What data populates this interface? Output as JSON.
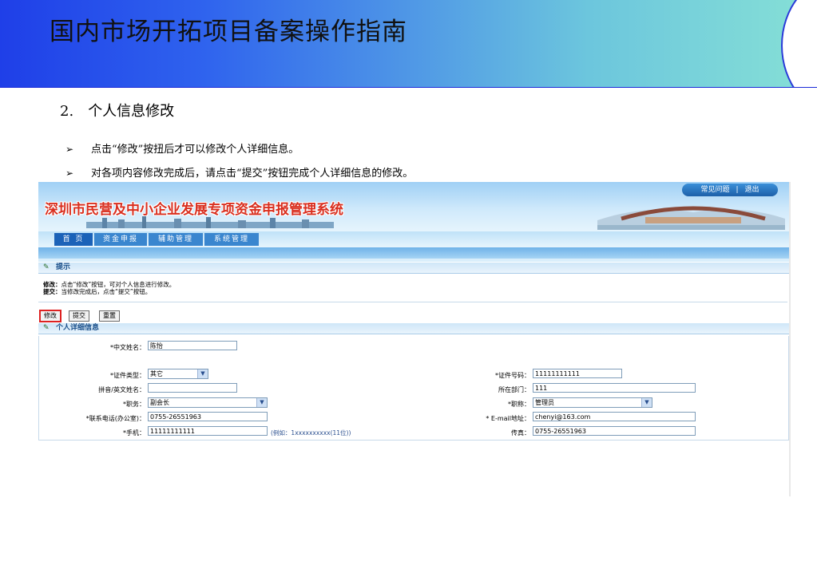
{
  "slide": {
    "title": "国内市场开拓项目备案操作指南",
    "section_number": "2.",
    "section_title": "个人信息修改",
    "bullets": [
      "点击“修改”按扭后才可以修改个人详细信息。",
      "对各项内容修改完成后，请点击“提交”按钮完成个人详细信息的修改。"
    ],
    "bullet_glyph": "➢"
  },
  "web": {
    "system_title": "深圳市民营及中小企业发展专项资金申报管理系统",
    "top_links": [
      "常见问题",
      "|",
      "退出"
    ],
    "nav": [
      "首 页",
      "资金申报",
      "辅助管理",
      "系统管理"
    ],
    "tips_header": "提示",
    "tips": [
      {
        "label": "修改：",
        "text": "点击“修改”按钮，可对个人信息进行修改。"
      },
      {
        "label": "提交：",
        "text": "当修改完成后，点击“提交”按钮。"
      }
    ],
    "buttons": {
      "edit": "修改",
      "submit": "提交",
      "reset": "重置"
    },
    "detail_header": "个人详细信息",
    "form": {
      "chinese_name": {
        "label": "*中文姓名：",
        "value": "陈怡"
      },
      "id_type": {
        "label": "*证件类型：",
        "value": "其它"
      },
      "id_number": {
        "label": "*证件号码：",
        "value": "11111111111"
      },
      "pinyin_name": {
        "label": "拼音/英文姓名：",
        "value": ""
      },
      "department": {
        "label": "所在部门：",
        "value": "111"
      },
      "position": {
        "label": "*职务：",
        "value": "副会长"
      },
      "job_title": {
        "label": "*职称：",
        "value": "管理员"
      },
      "office_phone": {
        "label": "*联系电话(办公室)：",
        "value": "0755-26551963"
      },
      "email": {
        "label": "* E-mail地址：",
        "value": "chenyi@163.com"
      },
      "mobile": {
        "label": "*手机：",
        "value": "11111111111",
        "hint": "(例如：1xxxxxxxxxx(11位))"
      },
      "fax": {
        "label": "传真：",
        "value": "0755-26551963"
      }
    }
  },
  "colors": {
    "header_gradient_start": "#1f3fe8",
    "header_gradient_end": "#86e0d6",
    "system_title_red": "#d92f1f",
    "required_red": "#e02020",
    "nav_blue": "#3a86cf"
  }
}
